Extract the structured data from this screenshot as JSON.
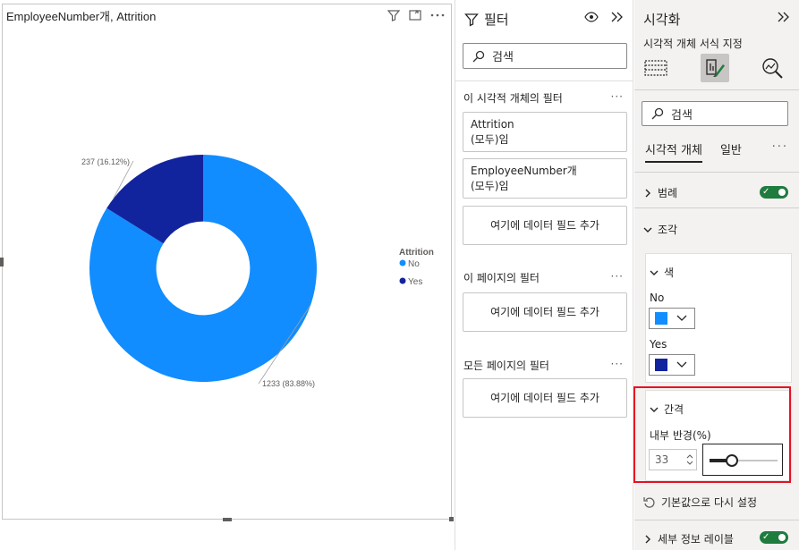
{
  "visual": {
    "title": "EmployeeNumber개, Attrition",
    "icons": [
      "filter-icon",
      "focus-mode-icon",
      "more-options-icon"
    ]
  },
  "chart_data": {
    "type": "pie",
    "subtype": "donut",
    "categories": [
      "No",
      "Yes"
    ],
    "values": [
      1233,
      237
    ],
    "percents": [
      83.88,
      16.12
    ],
    "data_labels": [
      "1233 (83.88%)",
      "237 (16.12%)"
    ],
    "colors": [
      "#118dff",
      "#12239e"
    ],
    "inner_radius_percent": 33,
    "legend": {
      "title": "Attrition",
      "position": "right",
      "entries": [
        "No",
        "Yes"
      ]
    }
  },
  "filters": {
    "title": "필터",
    "search_placeholder": "검색",
    "visual_section": "이 시각적 개체의 필터",
    "cards": [
      {
        "field": "Attrition",
        "state": "(모두)임"
      },
      {
        "field": "EmployeeNumber개",
        "state": "(모두)임"
      }
    ],
    "add_label": "여기에 데이터 필드 추가",
    "page_section": "이 페이지의 필터",
    "all_pages_section": "모든 페이지의 필터",
    "dots": "···"
  },
  "viz": {
    "title": "시각화",
    "subtitle": "시각적 개체 서식 지정",
    "search_placeholder": "검색",
    "tabs": [
      "시각적 개체",
      "일반"
    ],
    "tabs_dots": "···",
    "legend_row": "범례",
    "slices_row": "조각",
    "colors_row": "색",
    "no_label": "No",
    "yes_label": "Yes",
    "spacing_row": "간격",
    "inner_radius_label": "내부 반경(%)",
    "inner_radius_value": "33",
    "reset_label": "기본값으로 다시 설정",
    "detail_labels_row": "세부 정보 레이블",
    "colors": {
      "no": "#118dff",
      "yes": "#12239e",
      "toggle_on": "#1f7c3f",
      "highlight": "#e81123"
    }
  }
}
